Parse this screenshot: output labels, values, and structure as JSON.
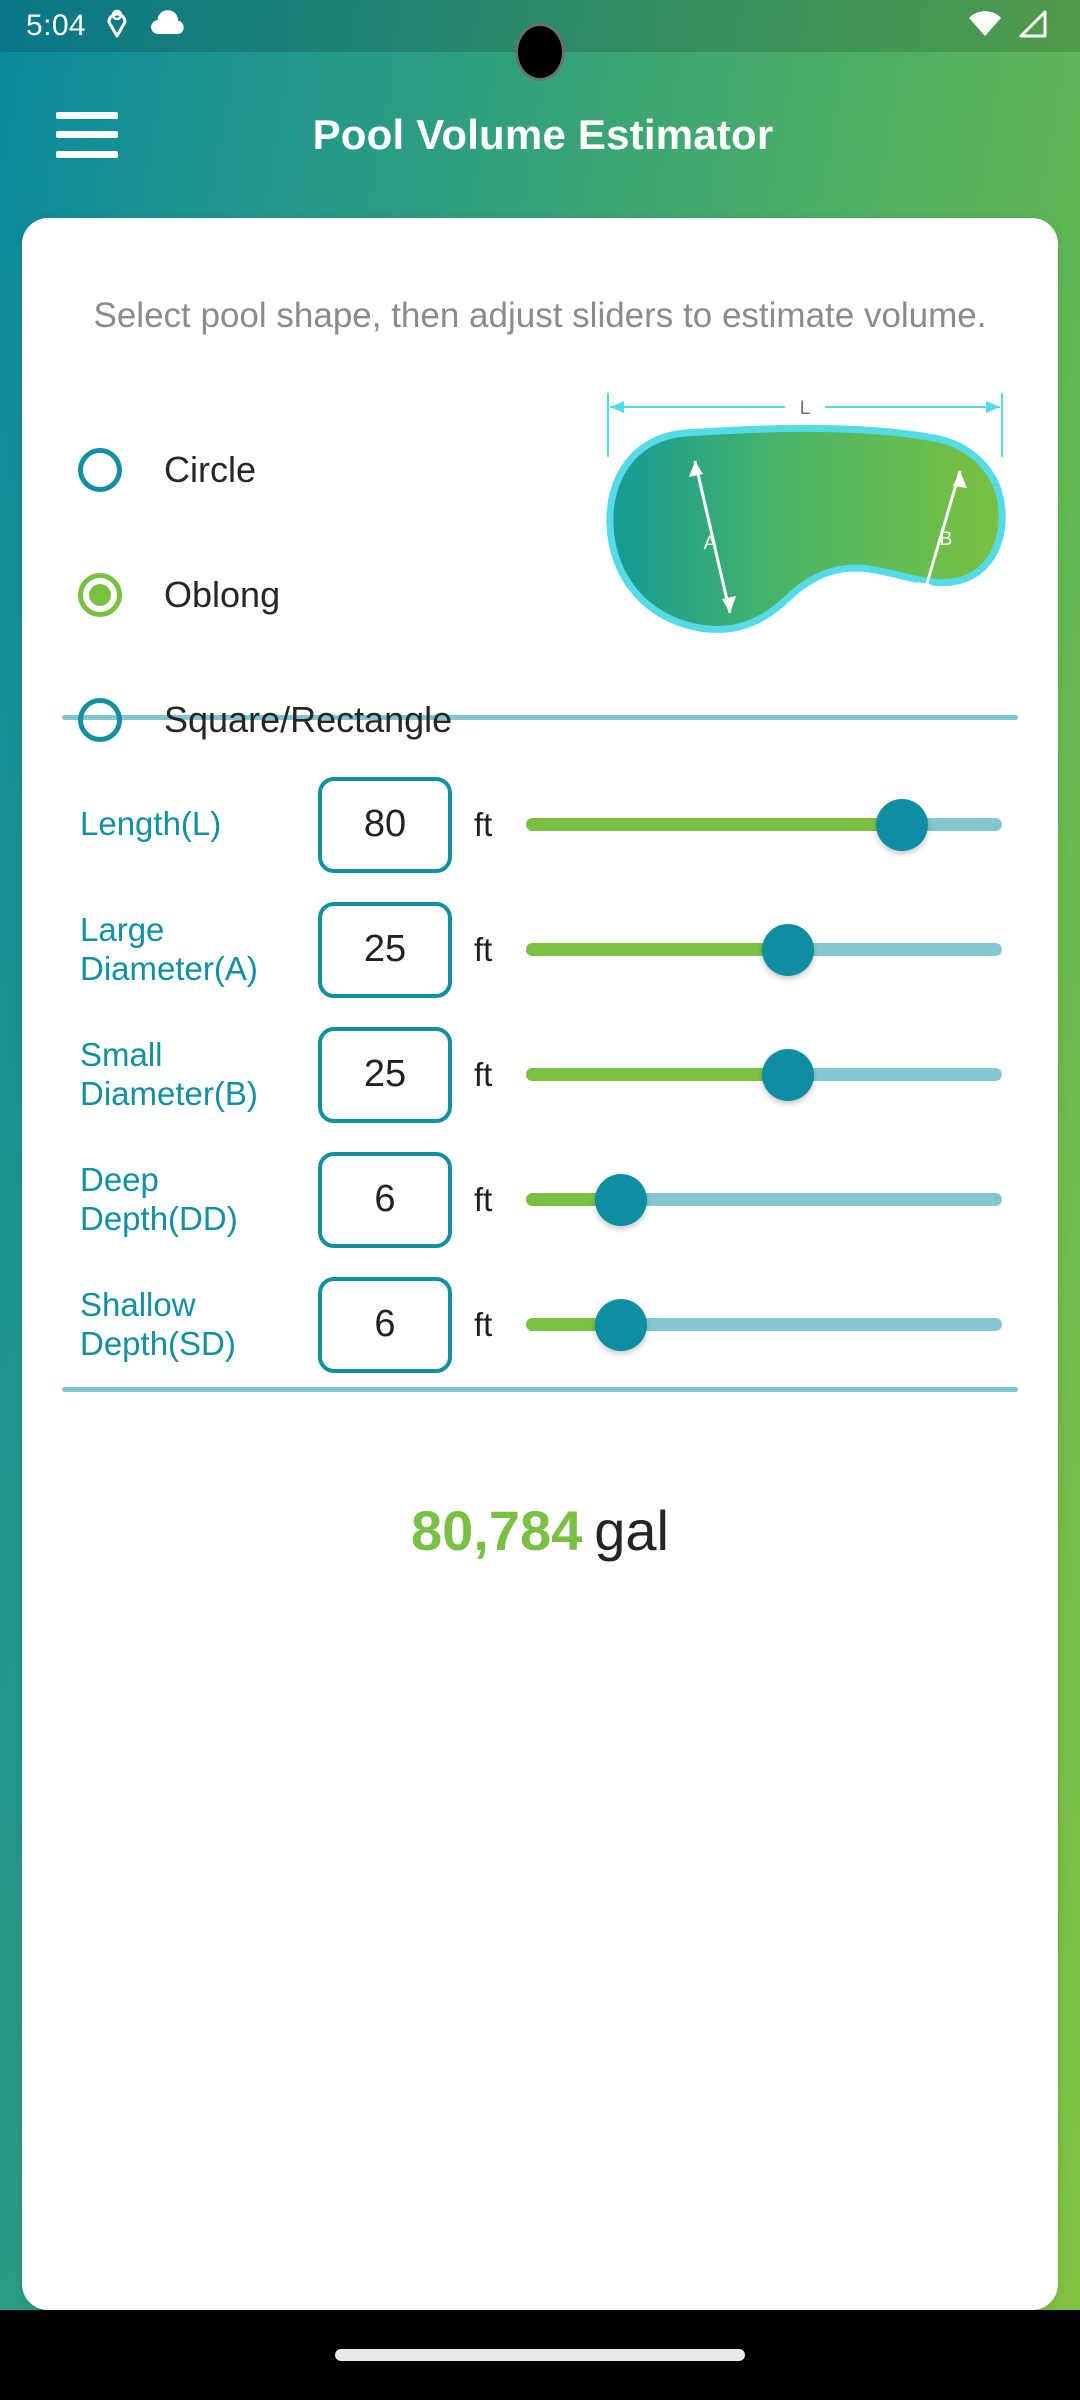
{
  "statusbar": {
    "time": "5:04",
    "icons": [
      "location-pin-icon",
      "cloud-icon"
    ],
    "right_icons": [
      "wifi-icon",
      "cellular-signal-icon"
    ]
  },
  "appbar": {
    "menu_icon": "hamburger-menu-icon",
    "title": "Pool Volume Estimator"
  },
  "card": {
    "instruction": "Select pool shape, then adjust sliders to estimate volume.",
    "shape_options": [
      {
        "label": "Circle",
        "selected": false
      },
      {
        "label": "Oblong",
        "selected": true
      },
      {
        "label": "Square/Rectangle",
        "selected": false
      }
    ],
    "diagram": {
      "name": "oblong-pool-shape-diagram",
      "labels": {
        "length": "L",
        "large_diameter": "A",
        "small_diameter": "B"
      }
    },
    "inputs": [
      {
        "label": "Length(L)",
        "value": "80",
        "unit": "ft",
        "slider_percent": 79
      },
      {
        "label": "Large\nDiameter(A)",
        "value": "25",
        "unit": "ft",
        "slider_percent": 55
      },
      {
        "label": "Small\nDiameter(B)",
        "value": "25",
        "unit": "ft",
        "slider_percent": 55
      },
      {
        "label": "Deep Depth(DD)",
        "value": "6",
        "unit": "ft",
        "slider_percent": 20
      },
      {
        "label": "Shallow\nDepth(SD)",
        "value": "6",
        "unit": "ft",
        "slider_percent": 20
      }
    ],
    "result": {
      "value": "80,784",
      "unit": "gal"
    }
  },
  "colors": {
    "teal": "#0e8ea2",
    "green": "#7ac143",
    "track_inactive": "#85c7cf",
    "label_teal": "#1190a4",
    "instruction_gray": "#8b8b8b",
    "pool_outline": "#55dbe8",
    "navbar": "#000000"
  }
}
